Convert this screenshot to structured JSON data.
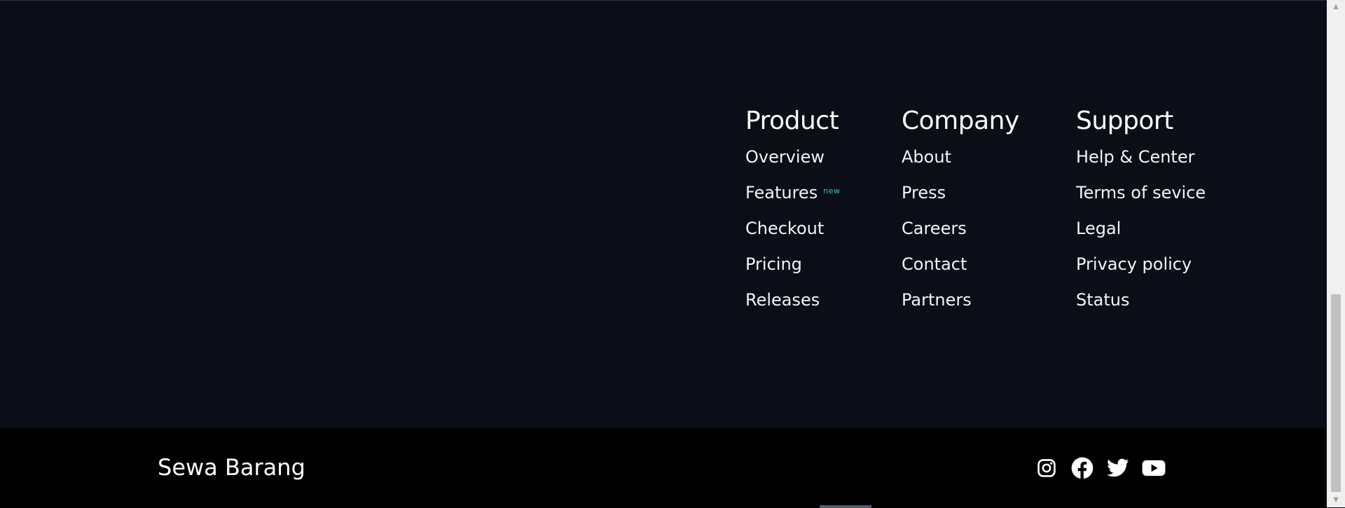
{
  "footer": {
    "columns": [
      {
        "title": "Product",
        "links": [
          "Overview",
          "Features",
          "Checkout",
          "Pricing",
          "Releases"
        ],
        "badge": "new"
      },
      {
        "title": "Company",
        "links": [
          "About",
          "Press",
          "Careers",
          "Contact",
          "Partners"
        ]
      },
      {
        "title": "Support",
        "links": [
          "Help & Center",
          "Terms of sevice",
          "Legal",
          "Privacy policy",
          "Status"
        ]
      }
    ],
    "brand": "Sewa Barang",
    "socials": [
      "instagram-icon",
      "facebook-icon",
      "twitter-icon",
      "youtube-icon"
    ]
  },
  "colors": {
    "background": "#0b0e17",
    "bottom_bar": "#000000",
    "text": "#ffffff",
    "badge": "#34c3cf"
  }
}
